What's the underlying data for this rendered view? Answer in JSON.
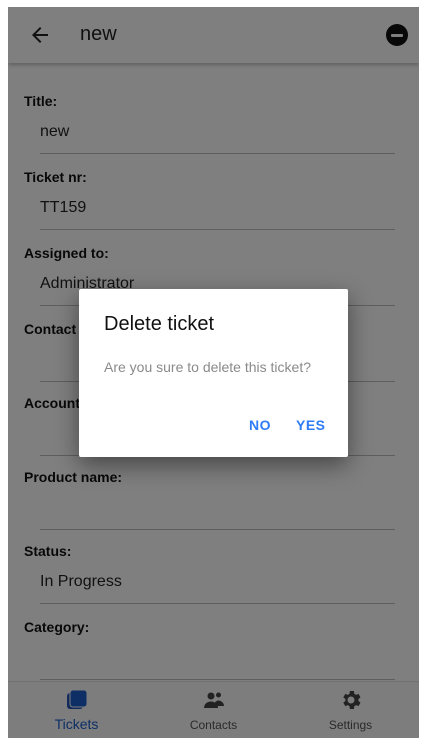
{
  "appbar": {
    "title": "new"
  },
  "fields": [
    {
      "label": "Title:",
      "value": "new"
    },
    {
      "label": "Ticket nr:",
      "value": "TT159"
    },
    {
      "label": "Assigned to:",
      "value": "Administrator"
    },
    {
      "label": "Contact name:",
      "value": ""
    },
    {
      "label": "Account name:",
      "value": ""
    },
    {
      "label": "Product name:",
      "value": ""
    },
    {
      "label": "Status:",
      "value": "In Progress"
    },
    {
      "label": "Category:",
      "value": ""
    }
  ],
  "dialog": {
    "title": "Delete ticket",
    "message": "Are you sure to delete this ticket?",
    "no_label": "NO",
    "yes_label": "YES"
  },
  "bottom_nav": {
    "items": [
      {
        "label": "Tickets",
        "icon": "tickets-icon",
        "active": true
      },
      {
        "label": "Contacts",
        "icon": "contacts-icon",
        "active": false
      },
      {
        "label": "Settings",
        "icon": "settings-icon",
        "active": false
      }
    ],
    "active_color": "#1a5fcc"
  },
  "colors": {
    "accent": "#2e7cf6"
  }
}
